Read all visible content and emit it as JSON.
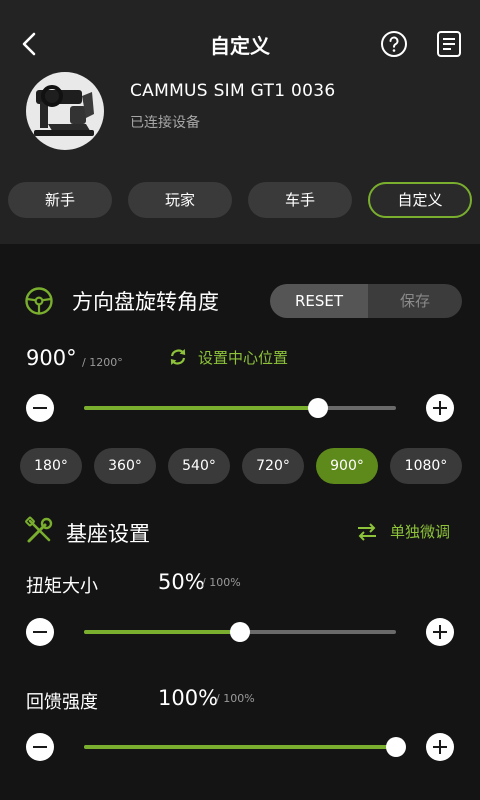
{
  "header": {
    "title": "自定义"
  },
  "device": {
    "name": "CAMMUS SIM GT1  0036",
    "status": "已连接设备"
  },
  "modes": [
    {
      "label": "新手",
      "active": false
    },
    {
      "label": "玩家",
      "active": false
    },
    {
      "label": "车手",
      "active": false
    },
    {
      "label": "自定义",
      "active": true
    }
  ],
  "steering": {
    "title": "方向盘旋转角度",
    "reset_label": "RESET",
    "save_label": "保存",
    "value": "900°",
    "max": "/ 1200°",
    "center_label": "设置中心位置",
    "slider_fraction": 0.75,
    "presets": [
      {
        "label": "180°",
        "active": false
      },
      {
        "label": "360°",
        "active": false
      },
      {
        "label": "540°",
        "active": false
      },
      {
        "label": "720°",
        "active": false
      },
      {
        "label": "900°",
        "active": true
      },
      {
        "label": "1080°",
        "active": false
      }
    ]
  },
  "base": {
    "title": "基座设置",
    "adjust_label": "单独微调",
    "torque": {
      "label": "扭矩大小",
      "value": "50%",
      "max": "/ 100%",
      "fraction": 0.5
    },
    "feedback": {
      "label": "回馈强度",
      "value": "100%",
      "max": "/ 100%",
      "fraction": 1.0
    }
  },
  "colors": {
    "accent": "#7aae2e",
    "accent_text": "#8dc23a",
    "background": "#141414",
    "header_bg": "#232323"
  },
  "icons": [
    "back-arrow-icon",
    "help-icon",
    "document-icon",
    "steering-wheel-icon",
    "refresh-icon",
    "tools-icon",
    "swap-arrows-icon"
  ]
}
